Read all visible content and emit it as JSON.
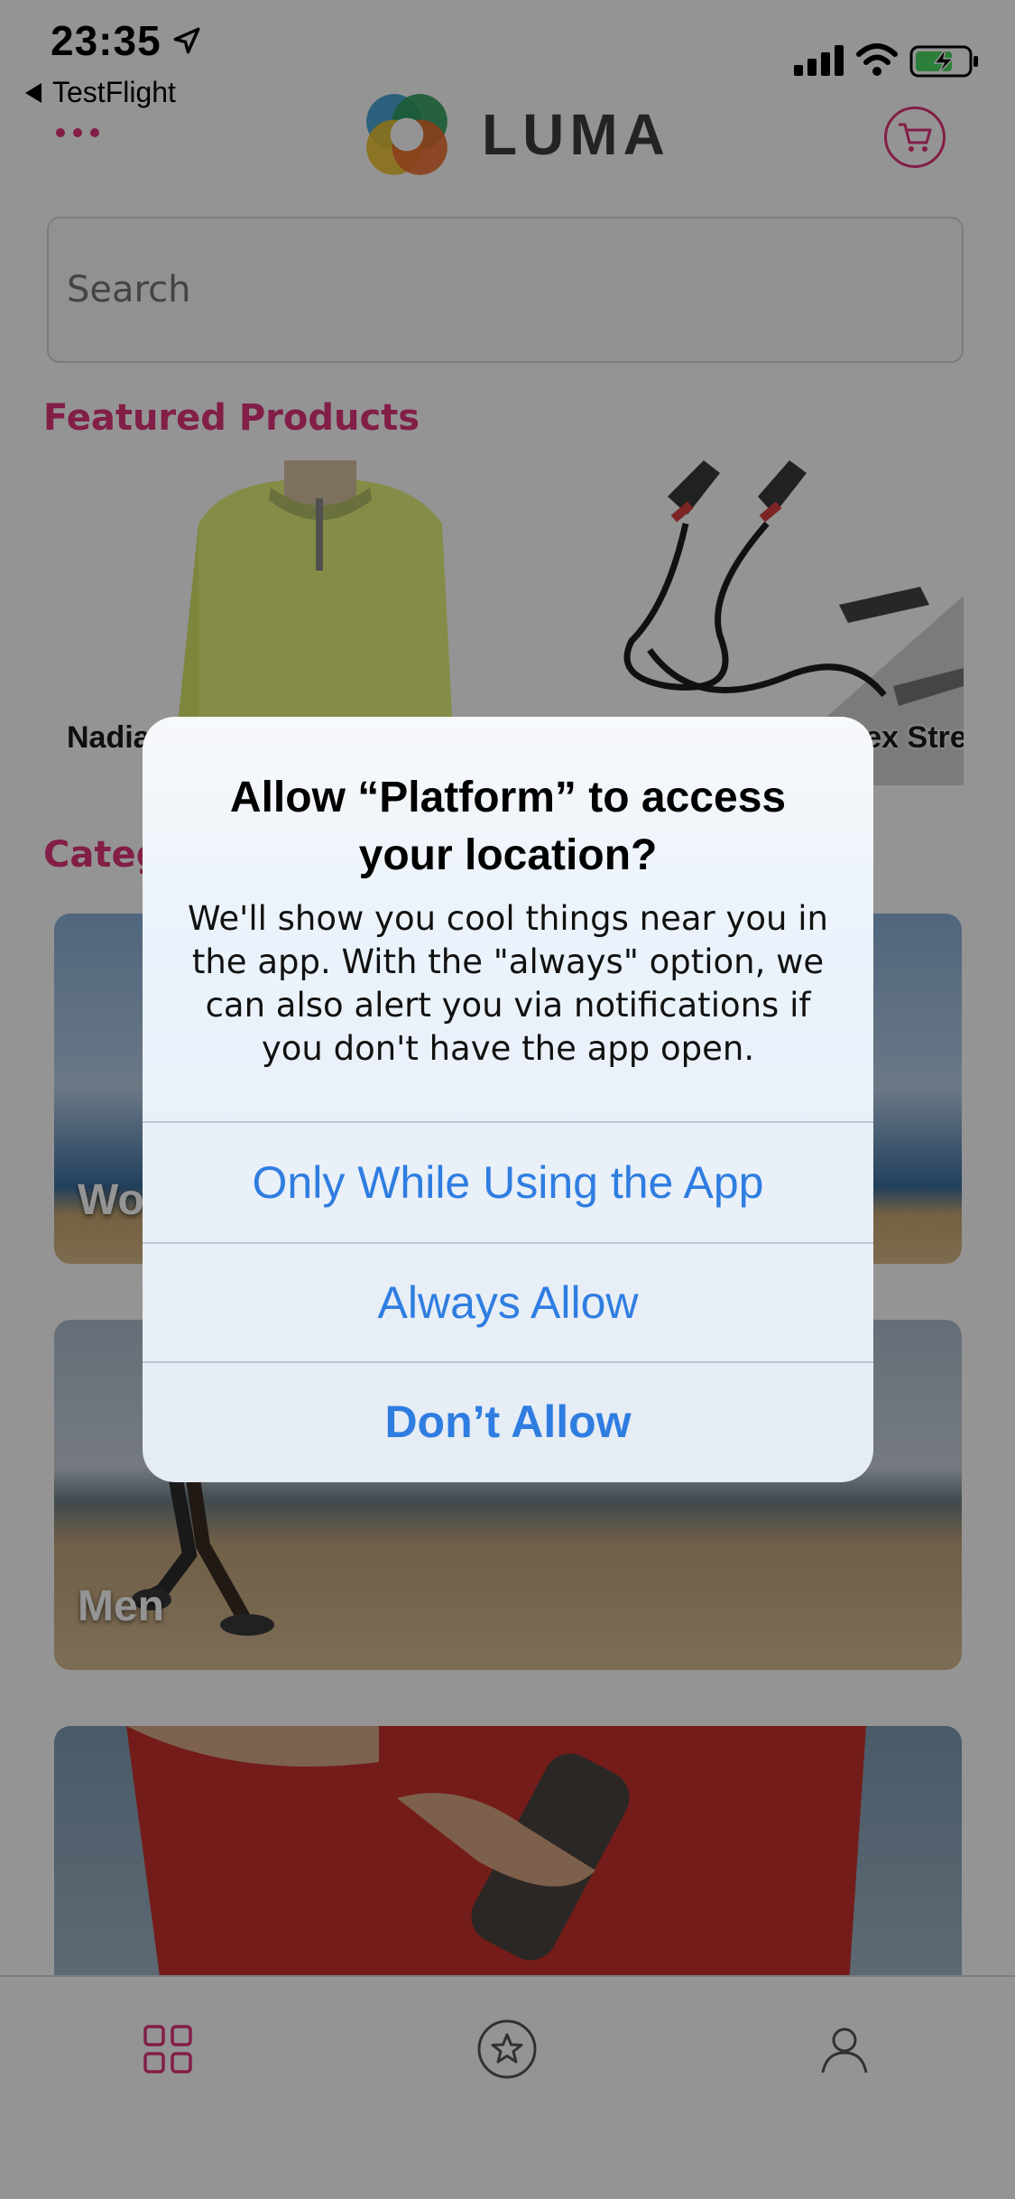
{
  "status_bar": {
    "time": "23:35",
    "back_label": "TestFlight"
  },
  "header": {
    "brand": "LUMA"
  },
  "search": {
    "placeholder": "Search"
  },
  "featured": {
    "title": "Featured Products",
    "products": [
      {
        "name": "Nadia"
      },
      {
        "name": "Harmony Lumaflex Strength"
      }
    ]
  },
  "categories": {
    "title": "Categories",
    "items": [
      {
        "label": "Women"
      },
      {
        "label": "Men"
      },
      {
        "label": ""
      }
    ]
  },
  "tabbar": {
    "items": [
      {
        "icon": "grid-icon",
        "active": true
      },
      {
        "icon": "star-icon",
        "active": false
      },
      {
        "icon": "person-icon",
        "active": false
      }
    ]
  },
  "alert": {
    "title": "Allow “Platform” to access your location?",
    "message": "We'll show you cool things near you in the app. With the \"always\" option, we can also alert you via notifications if you don't have the app open.",
    "buttons": {
      "while_using": "Only While Using the App",
      "always": "Always Allow",
      "dont_allow": "Don’t Allow"
    }
  },
  "colors": {
    "accent": "#e0357a",
    "alert_button": "#2f7de1",
    "battery_fill": "#4cd964"
  }
}
